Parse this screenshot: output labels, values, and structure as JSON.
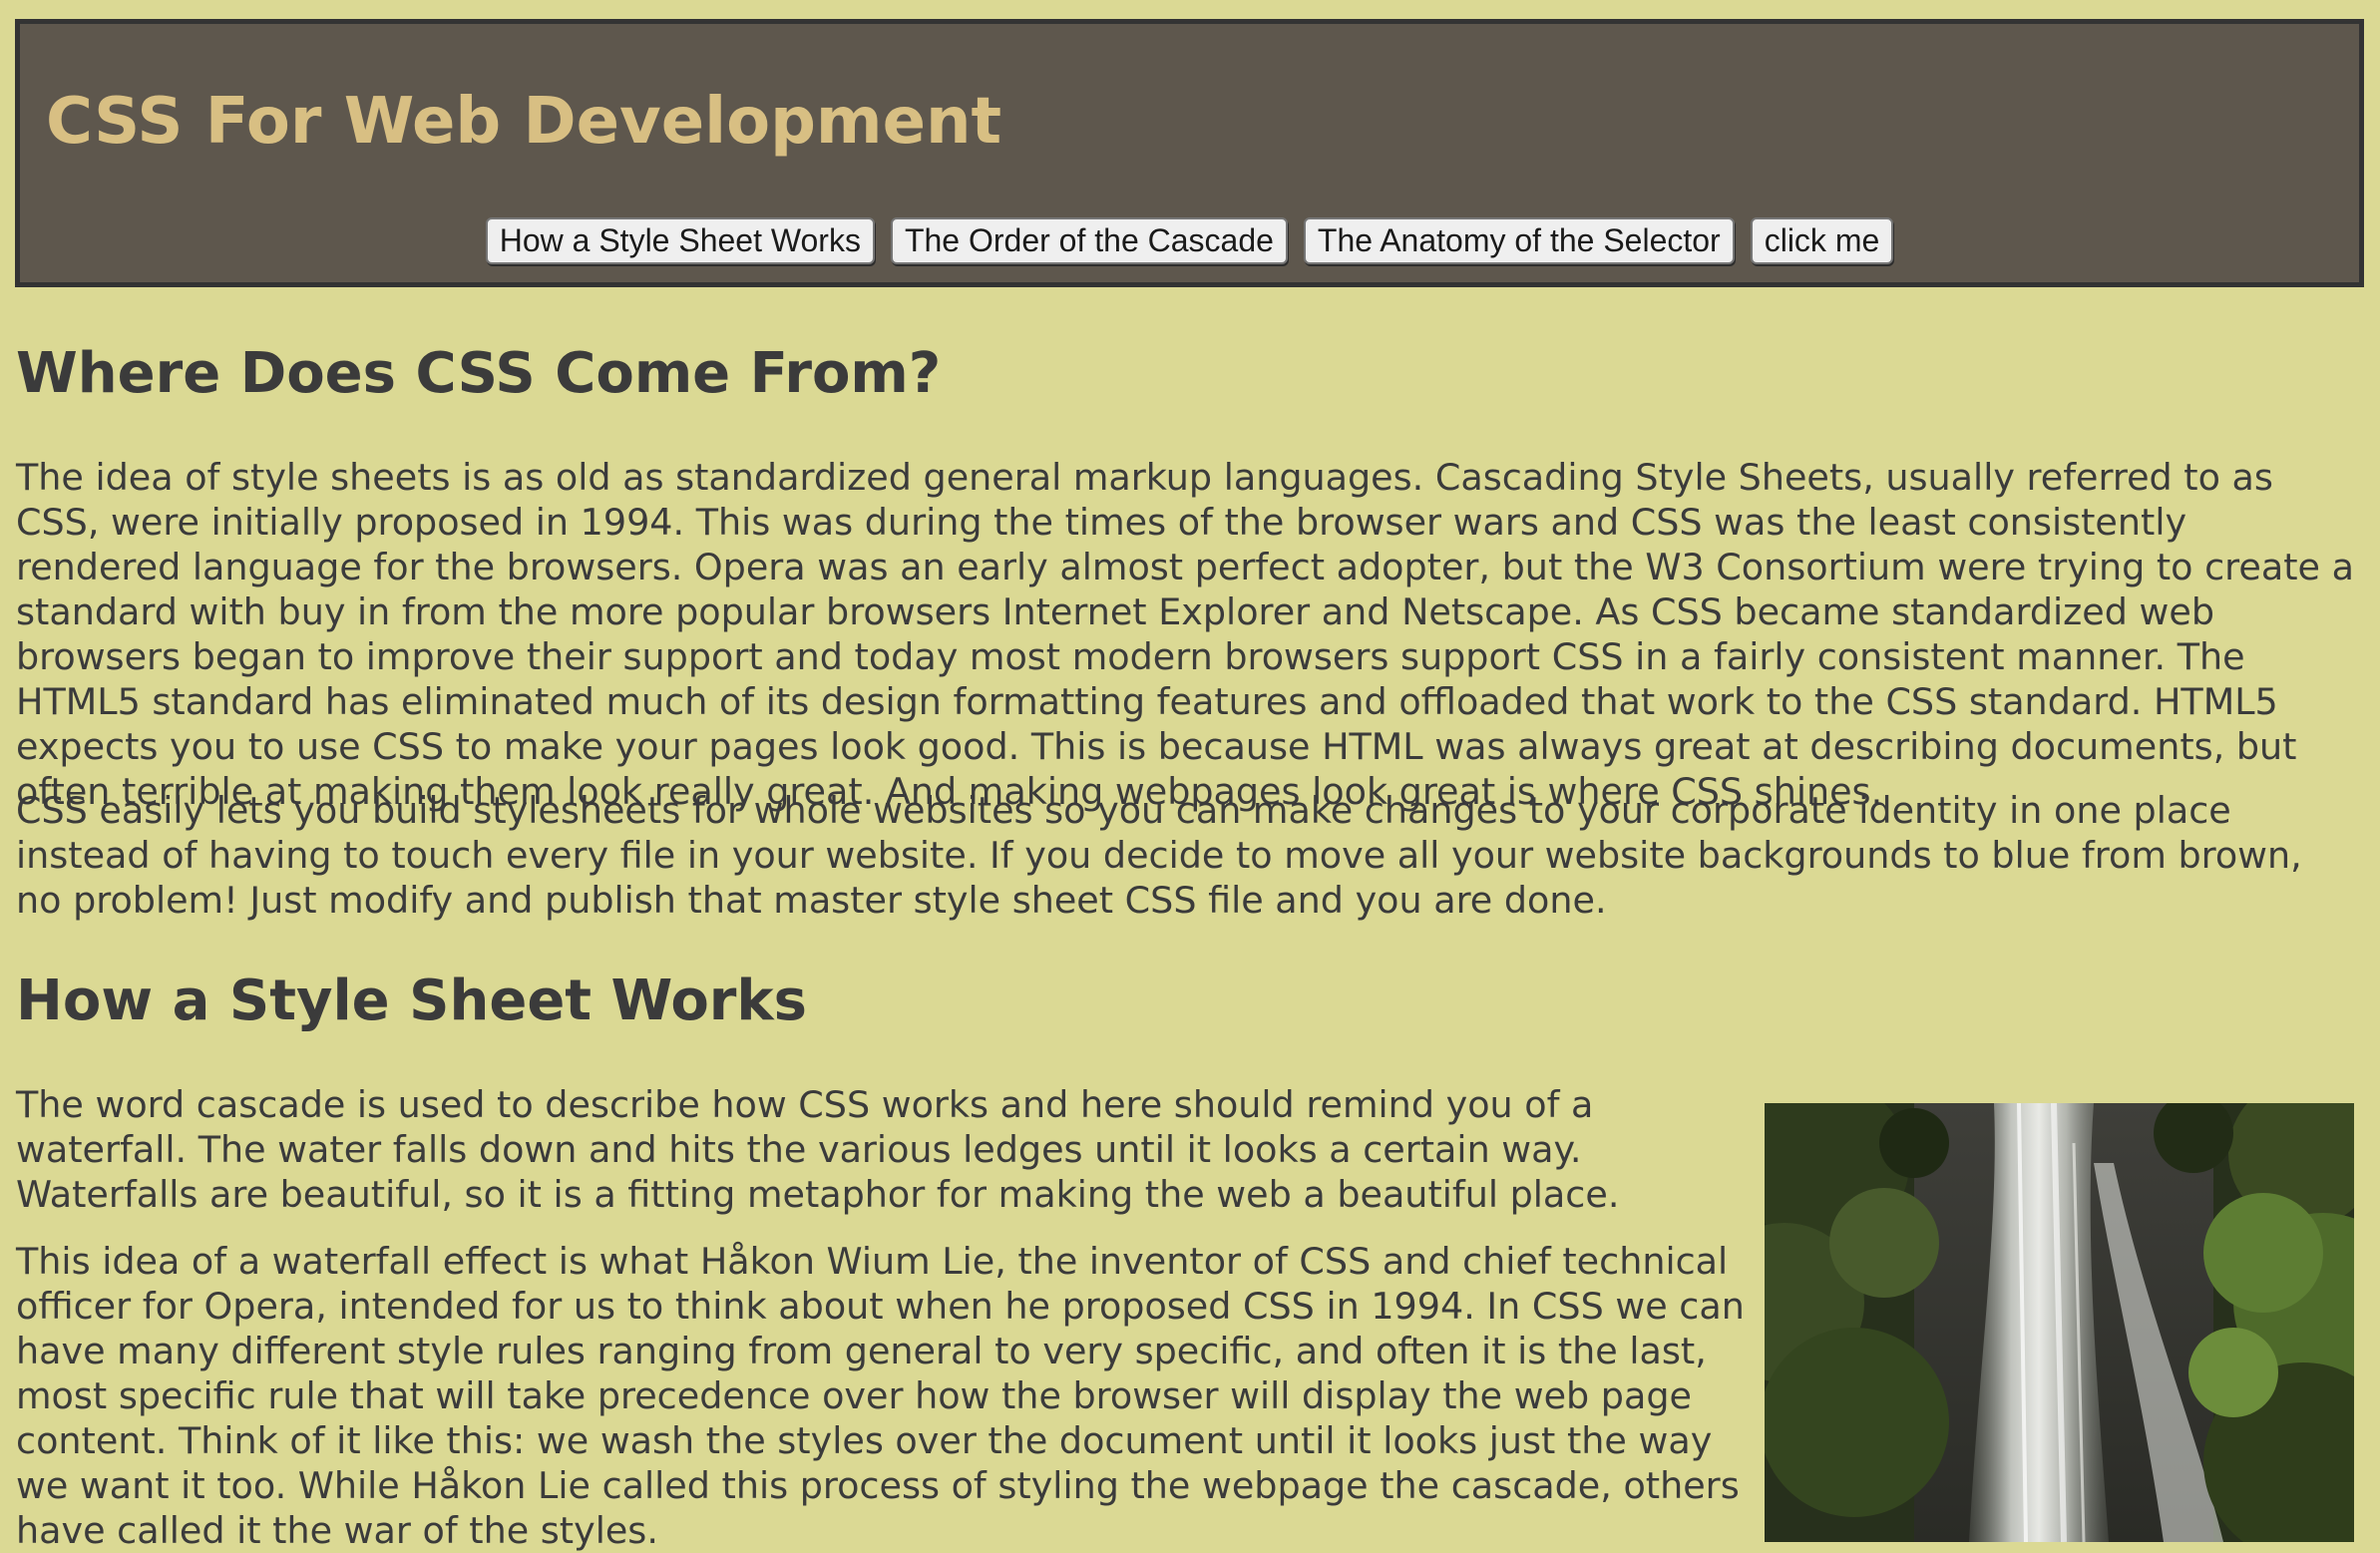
{
  "header": {
    "title": "CSS For Web Development",
    "nav": [
      "How a Style Sheet Works",
      "The Order of the Cascade",
      "The Anatomy of the Selector",
      "click me"
    ]
  },
  "sections": [
    {
      "heading": "Where Does CSS Come From?",
      "paragraphs": [
        "The idea of style sheets is as old as standardized general markup languages. Cascading Style Sheets, usually referred to as CSS, were initially proposed in 1994. This was during the times of the browser wars and CSS was the least consistently rendered language for the browsers. Opera was an early almost perfect adopter, but the W3 Consortium were trying to create a standard with buy in from the more popular browsers Internet Explorer and Netscape. As CSS became standardized web browsers began to improve their support and today most modern browsers support CSS in a fairly consistent manner. The HTML5 standard has eliminated much of its design formatting features and offloaded that work to the CSS standard. HTML5 expects you to use CSS to make your pages look good. This is because HTML was always great at describing documents, but often terrible at making them look really great. And making webpages look great is where CSS shines.",
        "CSS easily lets you build stylesheets for whole websites so you can make changes to your corporate identity in one place instead of having to touch every file in your website. If you decide to move all your website backgrounds to blue from brown, no problem! Just modify and publish that master style sheet CSS file and you are done."
      ]
    },
    {
      "heading": "How a Style Sheet Works",
      "paragraphs": [
        "The word cascade is used to describe how CSS works and here should remind you of a waterfall. The water falls down and hits the various ledges until it looks a certain way. Waterfalls are beautiful, so it is a fitting metaphor for making the web a beautiful place.",
        "This idea of a waterfall effect is what Håkon Wium Lie, the inventor of CSS and chief technical officer for Opera, intended for us to think about when he proposed CSS in 1994. In CSS we can have many different style rules ranging from general to very specific, and often it is the last, most specific rule that will take precedence over how the browser will display the web page content. Think of it like this: we wash the styles over the document until it looks just the way we want it too. While Håkon Lie called this process of styling the webpage the cascade, others have called it the war of the styles."
      ]
    }
  ],
  "colors": {
    "page_background": "#dbd994",
    "header_background": "#5e574d",
    "title_color": "#d8bf83",
    "text_color": "#3b3b3b"
  }
}
